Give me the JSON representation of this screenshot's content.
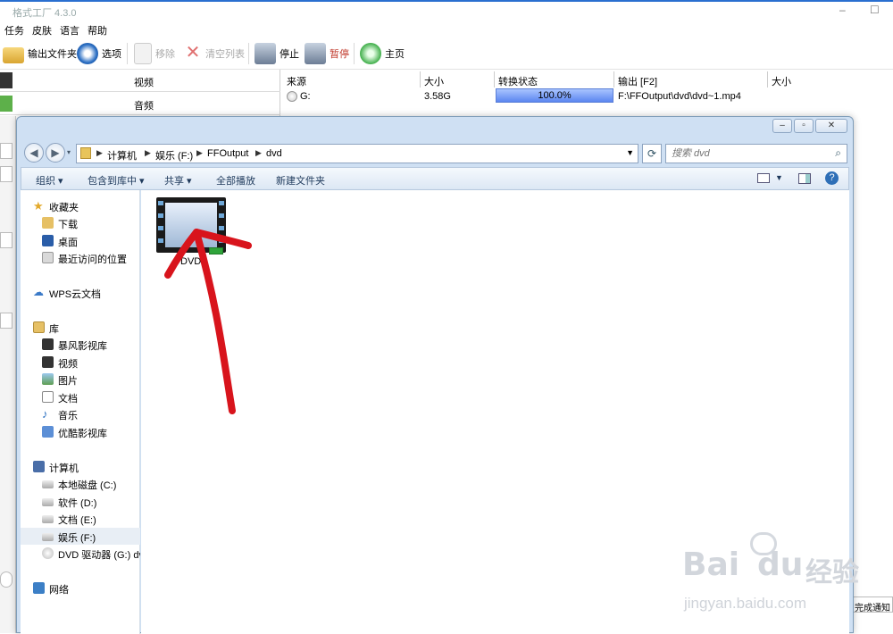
{
  "app": {
    "title": "格式工厂 4.3.0",
    "menu": [
      "任务",
      "皮肤",
      "语言",
      "帮助"
    ],
    "toolbar": {
      "output_folder": "输出文件夹",
      "options": "选项",
      "remove": "移除",
      "clear_list": "清空列表",
      "stop": "停止",
      "pause": "暂停",
      "home": "主页"
    },
    "categories": [
      "视频",
      "音频"
    ],
    "table": {
      "headers": [
        "来源",
        "大小",
        "转换状态",
        "输出 [F2]",
        "大小"
      ],
      "row": {
        "source": "G:",
        "size": "3.58G",
        "progress_text": "100.0%",
        "progress": 1.0,
        "output": "F:\\FFOutput\\dvd\\dvd~1.mp4"
      }
    },
    "notice": "完成通知"
  },
  "explorer": {
    "breadcrumb": [
      "计算机",
      "娱乐 (F:)",
      "FFOutput",
      "dvd"
    ],
    "search_placeholder": "搜索 dvd",
    "commands": [
      "组织 ▾",
      "包含到库中 ▾",
      "共享 ▾",
      "全部播放",
      "新建文件夹"
    ],
    "nav": {
      "favorites": "收藏夹",
      "downloads": "下载",
      "desktop": "桌面",
      "recent": "最近访问的位置",
      "wps": "WPS云文档",
      "libraries": "库",
      "storm": "暴风影视库",
      "videos": "视频",
      "pictures": "图片",
      "documents": "文档",
      "music": "音乐",
      "youku": "优酷影视库",
      "computer": "计算机",
      "drive_c": "本地磁盘 (C:)",
      "drive_d": "软件 (D:)",
      "drive_e": "文档 (E:)",
      "drive_f": "娱乐 (F:)",
      "drive_g": "DVD 驱动器 (G:) dv",
      "network": "网络"
    },
    "file": {
      "name": "DVD"
    }
  },
  "watermark": {
    "brand": "Bai",
    "cn": "经验",
    "url": "jingyan.baidu.com"
  },
  "colors": {
    "accent": "#2a6fd0",
    "annotation": "#d8141c",
    "progress": "#5b86f0"
  }
}
